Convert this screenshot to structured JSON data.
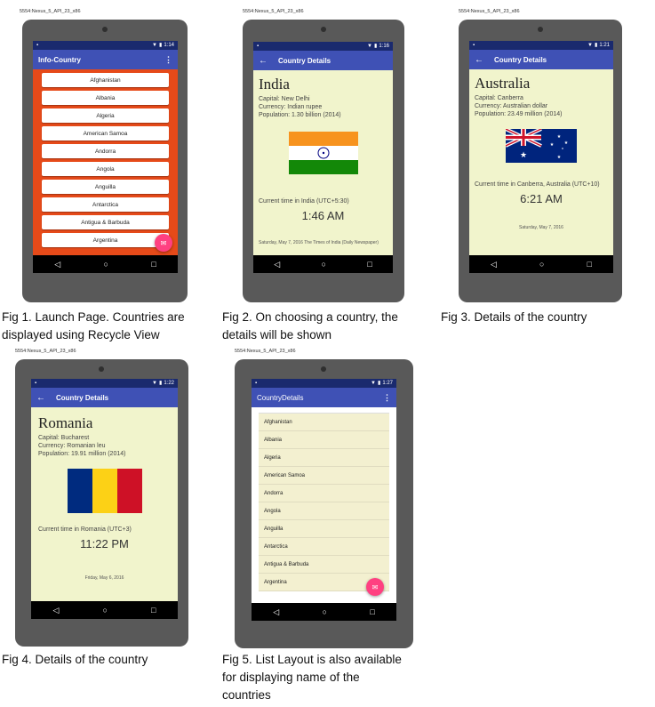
{
  "emulator_label": "5554:Nexus_5_API_23_x86",
  "nav": {
    "back": "◁",
    "home": "○",
    "recents": "□"
  },
  "panels": [
    {
      "time": "1:14",
      "app_title": "Info-Country",
      "countries": [
        "Afghanistan",
        "Albania",
        "Algeria",
        "American Samoa",
        "Andorra",
        "Angola",
        "Anguilla",
        "Antarctica",
        "Antigua & Barbuda",
        "Argentina"
      ],
      "caption_lines": [
        "Fig 1. Launch Page. Countries are",
        "displayed using Recycle View"
      ]
    },
    {
      "time": "1:16",
      "app_title": "Country Details",
      "country": "India",
      "capital": "Capital: New Delhi",
      "currency": "Currency: Indian rupee",
      "population": "Population: 1.30 billion (2014)",
      "time_label": "Current time in India (UTC+5:30)",
      "current_time": "1:46 AM",
      "footnote": "Saturday, May 7, 2016 The Times of India (Daily Newspaper)",
      "caption_lines": [
        "Fig 2. On choosing a country, the",
        "details will be shown"
      ]
    },
    {
      "time": "1:21",
      "app_title": "Country Details",
      "country": "Australia",
      "capital": "Capital: Canberra",
      "currency": "Currency: Australian dollar",
      "population": "Population: 23.49 million (2014)",
      "time_label": "Current time in Canberra, Australia (UTC+10)",
      "current_time": "6:21 AM",
      "footnote": "Saturday, May 7, 2016",
      "caption_lines": [
        "Fig 3. Details of the country"
      ]
    },
    {
      "time": "1:22",
      "app_title": "Country Details",
      "country": "Romania",
      "capital": "Capital: Bucharest",
      "currency": "Currency: Romanian leu",
      "population": "Population: 19.91 million (2014)",
      "time_label": "Current time in Romania (UTC+3)",
      "current_time": "11:22 PM",
      "footnote": "Friday, May 6, 2016",
      "caption_lines": [
        "Fig 4. Details of the country"
      ]
    },
    {
      "time": "1:27",
      "app_title": "CountryDetails",
      "countries": [
        "Afghanistan",
        "Albania",
        "Algeria",
        "American Samoa",
        "Andorra",
        "Angola",
        "Anguilla",
        "Antarctica",
        "Antigua & Barbuda",
        "Argentina"
      ],
      "caption_lines": [
        "Fig 5. List Layout is also available",
        "for displaying name of the",
        "countries"
      ]
    }
  ],
  "colors": {
    "primary": "#3f51b5",
    "status_bar": "#1a2a6e",
    "launch_background": "#e64a19",
    "detail_background": "#f1f4cc",
    "fab": "#ff4081"
  },
  "icons": [
    "overflow-menu-icon",
    "back-arrow-icon",
    "mail-icon",
    "wifi-icon",
    "battery-icon",
    "sim-icon"
  ]
}
